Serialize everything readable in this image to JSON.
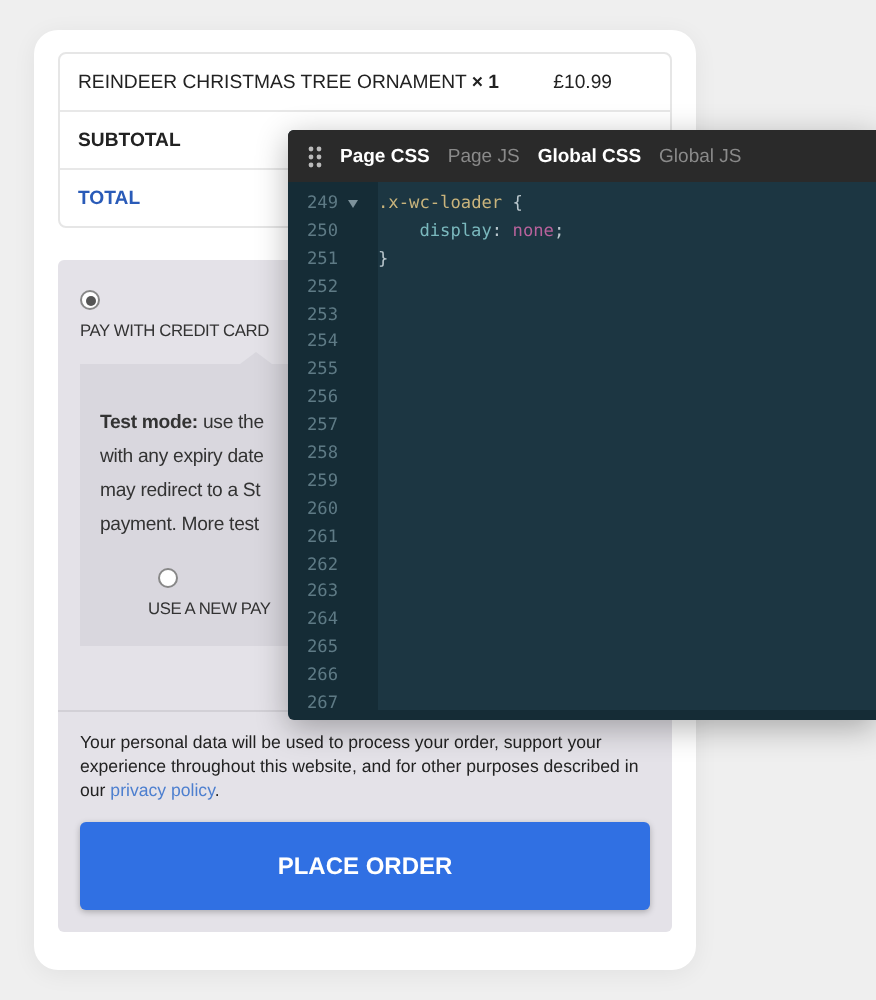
{
  "order_table": {
    "rows": [
      {
        "kind": "item",
        "label": "REINDEER CHRISTMAS TREE ORNAMENT **× 1**",
        "value": "£10.99"
      },
      {
        "kind": "subtotal",
        "label": "SUBTOTAL"
      },
      {
        "kind": "total",
        "label": "TOTAL"
      }
    ]
  },
  "payment": {
    "method": {
      "label": "PAY WITH CREDIT CARD",
      "selected": true
    },
    "info_lines": [
      "**Test mode:** use the",
      "with any expiry date",
      "may redirect to a St",
      "payment. More test"
    ],
    "saved_option": {
      "label": "USE A NEW PAY",
      "selected": false
    }
  },
  "privacy": {
    "text_before": "Your personal data will be used to process your order, support your experience throughout this website, and for other purposes described in our ",
    "link": "privacy policy",
    "text_after": "."
  },
  "place_order_button": "PLACE ORDER",
  "code_editor": {
    "tabs": [
      {
        "label": "Page CSS",
        "active": true
      },
      {
        "label": "Page JS",
        "active": false
      },
      {
        "label": "Global CSS",
        "active": true
      },
      {
        "label": "Global JS",
        "active": false
      }
    ],
    "lines": [
      {
        "number": "249",
        "foldable": true,
        "tokens": [
          {
            "kind": "selector",
            "text": ".x-wc-loader"
          },
          {
            "kind": "plain",
            "text": " {"
          }
        ]
      },
      {
        "number": "250",
        "foldable": false,
        "tokens": [
          {
            "kind": "property",
            "text": "display"
          },
          {
            "kind": "plain",
            "text": ": "
          },
          {
            "kind": "value",
            "text": "none"
          },
          {
            "kind": "plain",
            "text": ";"
          }
        ]
      },
      {
        "number": "251",
        "foldable": false,
        "tokens": [
          {
            "kind": "plain",
            "text": "}"
          }
        ]
      },
      {
        "number": "252",
        "foldable": false
      },
      {
        "number": "253",
        "foldable": false
      },
      {
        "number": "254",
        "foldable": false
      },
      {
        "number": "255",
        "foldable": false
      },
      {
        "number": "256",
        "foldable": false
      },
      {
        "number": "257",
        "foldable": false
      },
      {
        "number": "258",
        "foldable": false
      },
      {
        "number": "259",
        "foldable": false
      },
      {
        "number": "260",
        "foldable": false
      },
      {
        "number": "261",
        "foldable": false
      },
      {
        "number": "262",
        "foldable": false
      },
      {
        "number": "263",
        "foldable": false
      },
      {
        "number": "264",
        "foldable": false
      },
      {
        "number": "265",
        "foldable": false
      },
      {
        "number": "266",
        "foldable": false
      },
      {
        "number": "267",
        "foldable": false
      }
    ]
  }
}
